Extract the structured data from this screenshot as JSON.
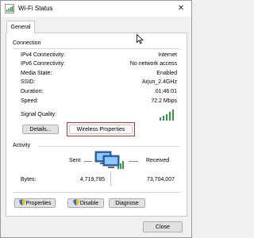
{
  "window": {
    "title": "Wi-Fi Status",
    "close_glyph": "✕"
  },
  "tabs": [
    {
      "label": "General"
    }
  ],
  "connection": {
    "heading": "Connection",
    "rows": [
      {
        "label": "IPv4 Connectivity:",
        "value": "Internet"
      },
      {
        "label": "IPv6 Connectivity:",
        "value": "No network access"
      },
      {
        "label": "Media State:",
        "value": "Enabled"
      },
      {
        "label": "SSID:",
        "value": "Arjun_2.4GHz"
      },
      {
        "label": "Duration:",
        "value": "01:46:01"
      },
      {
        "label": "Speed:",
        "value": "72.2 Mbps"
      }
    ],
    "signal_quality_label": "Signal Quality:",
    "signal_bars_active": 5,
    "details_button": "Details...",
    "wireless_properties_button": "Wireless Properties"
  },
  "activity": {
    "heading": "Activity",
    "sent_label": "Sent",
    "received_label": "Received",
    "bytes_label": "Bytes:",
    "bytes_sent": "4,719,785",
    "bytes_received": "73,704,007",
    "properties_button": "Properties",
    "disable_button": "Disable",
    "diagnose_button": "Diagnose"
  },
  "footer": {
    "close_button": "Close"
  },
  "icons": {
    "title": "wifi-icon",
    "network": "network-computers-icon",
    "shield": "uac-shield-icon",
    "cursor": "mouse-pointer-icon"
  }
}
